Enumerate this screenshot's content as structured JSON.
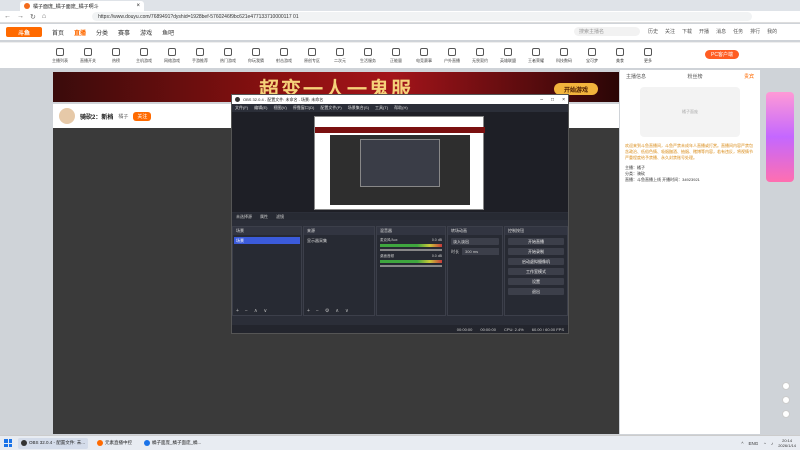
{
  "browser": {
    "tab_title": "橘子面庞_橘子面庞_橘子啊斗",
    "url": "https://www.douyu.com/7689491?dyshid=1928bef-5760246f9bc621e477133710000117 01",
    "nav": [
      "←",
      "→",
      "↻",
      "⌂"
    ]
  },
  "douyu": {
    "logo": "斗鱼",
    "nav": [
      "首页",
      "直播",
      "分类",
      "赛事",
      "游戏",
      "鱼吧"
    ],
    "search_placeholder": "搜索主播名",
    "header_icons": [
      "历史",
      "关注",
      "下载",
      "开播",
      "消息",
      "任务",
      "排行",
      "我的"
    ],
    "categories": [
      "主播列表",
      "直播开关",
      "热榜",
      "主机游戏",
      "网络游戏",
      "手游推荐",
      "热门游戏",
      "你玩我猜",
      "射击游戏",
      "原创专区",
      "二次元",
      "生活服务",
      "正能量",
      "电竞赛事",
      "户外直播",
      "无畏契约",
      "英雄联盟",
      "王者荣耀",
      "科技数码",
      "宝可梦",
      "美食",
      "更多"
    ],
    "pc_button": "PC客户端",
    "banner_text": "超变一人一鬼服",
    "start_game": "开始游戏",
    "streamer_name": "骑砍2：新档",
    "streamer_tag": "橘子",
    "follow_label": "关注",
    "right_tabs": [
      "主播信息",
      "粉丝榜",
      "贵宾"
    ],
    "right_img_caption": "橘子面庞",
    "right_text": "欢迎来到斗鱼直播间，斗鱼严禁未成年人直播或打赏。直播间内容严禁包含政治、低俗色情、吸烟酗酒、抽烟、赌博等内容，若有违反，将视情节严重程度给予禁播、永久封禁账号处理。",
    "right_meta": [
      "主播：橘子",
      "分类：骑砍",
      "直播：斗鱼直播上线  开播时间：34923921"
    ]
  },
  "obs": {
    "title": "OBS 32.0.4 - 配置文件: 未命名 - 场景: 未命名",
    "menu": [
      "文件(F)",
      "编辑(E)",
      "视图(V)",
      "停靠窗口(D)",
      "配置文件(P)",
      "场景集合(S)",
      "工具(T)",
      "帮助(H)"
    ],
    "scene_tabs": [
      "未选择源",
      "属性",
      "滤镜"
    ],
    "docks": {
      "scenes": "场景",
      "sources": "来源",
      "mixer": "混音器",
      "transitions": "转场动画",
      "controls": "控制按钮"
    },
    "scene_item": "场景",
    "source_item": "显示器采集",
    "mixer_tracks": [
      "麦克风/Aux",
      "桌面音频"
    ],
    "mixer_level": "0.0 dB",
    "transition": "淡入淡出",
    "duration_label": "时长",
    "duration_value": "300 ms",
    "controls": [
      "开始直播",
      "开始录制",
      "启动虚拟摄像机",
      "工作室模式",
      "设置",
      "退出"
    ],
    "status": [
      "00:00:00",
      "00:00:00",
      "CPU: 2.4%",
      "60.00 / 60.00 FPS"
    ]
  },
  "taskbar": {
    "apps": [
      "OBS 32.0.4 - 配置文件: 未...",
      "元素直播中控",
      "橘子面庞_橘子面庞_橘..."
    ],
    "tray": [
      "^",
      "ENG"
    ],
    "time": "20:14",
    "date": "2026/1/14"
  },
  "colors": {
    "accent": "#ff6a00",
    "obs_bg": "#2b2e38",
    "obs_select": "#3b5bdb"
  }
}
